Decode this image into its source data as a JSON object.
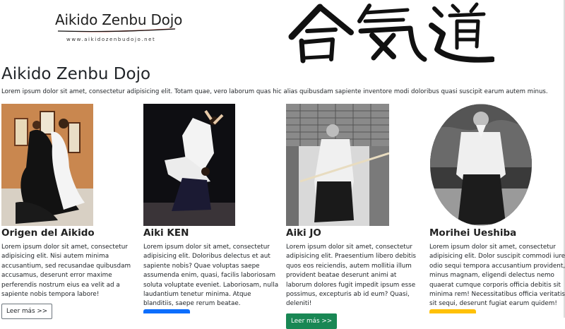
{
  "logo": {
    "title": "Aikido Zenbu Dojo",
    "url": "www.aikidozenbudojo.net"
  },
  "kanji_banner": {
    "icon": "aikido-kanji-calligraphy"
  },
  "page": {
    "title": "Aikido Zenbu Dojo",
    "intro": "Lorem ipsum dolor sit amet, consectetur adipisicing elit. Totam quae, vero laborum quas hic alias quibusdam sapiente inventore modi doloribus quasi suscipit earum autem minus."
  },
  "cards": [
    {
      "title": "Origen del Aikido",
      "image": "aikido-throw-photo",
      "text": "Lorem ipsum dolor sit amet, consectetur adipisicing elit. Nisi autem minima accusantium, sed recusandae quibusdam accusamus, deserunt error maxime perferendis nostrum eius ea velit ad a sapiente nobis tempora labore!",
      "button": "Leer más >>"
    },
    {
      "title": "Aiki KEN",
      "image": "aiki-ken-throw-photo",
      "text": "Lorem ipsum dolor sit amet, consectetur adipisicing elit. Doloribus delectus et aut sapiente nobis? Quae voluptas saepe assumenda enim, quasi, facilis laboriosam soluta voluptate eveniet. Laboriosam, nulla laudantium tenetur minima. Atque blanditiis, saepe rerum beatae."
    },
    {
      "title": "Aiki JO",
      "image": "aiki-jo-staff-photo",
      "text": "Lorem ipsum dolor sit amet, consectetur adipisicing elit. Praesentium libero debitis quos eos reiciendis, autem mollitia illum provident beatae deserunt animi at laborum dolores fugit impedit ipsum esse possimus, excepturis ab id eum? Quasi, deleniti!",
      "button": "Leer más >>"
    },
    {
      "title": "Morihei Ueshiba",
      "image": "morihei-ueshiba-portrait",
      "text": "Lorem ipsum dolor sit amet, consectetur adipisicing elit. Dolor suscipit commodi iure odio sequi tempora accusantium provident, minus magnam, eligendi delectus nemo quaerat cumque corporis officia debitis sit minima rem! Necessitatibus officia veritatis sit sequi, deserunt fugiat earum quidem!"
    }
  ],
  "colors": {
    "button_outline": "#6c757d",
    "button_success": "#198754",
    "button_primary": "#0d6efd",
    "button_warning": "#ffc107",
    "logo_swoosh": "#c0392b"
  }
}
